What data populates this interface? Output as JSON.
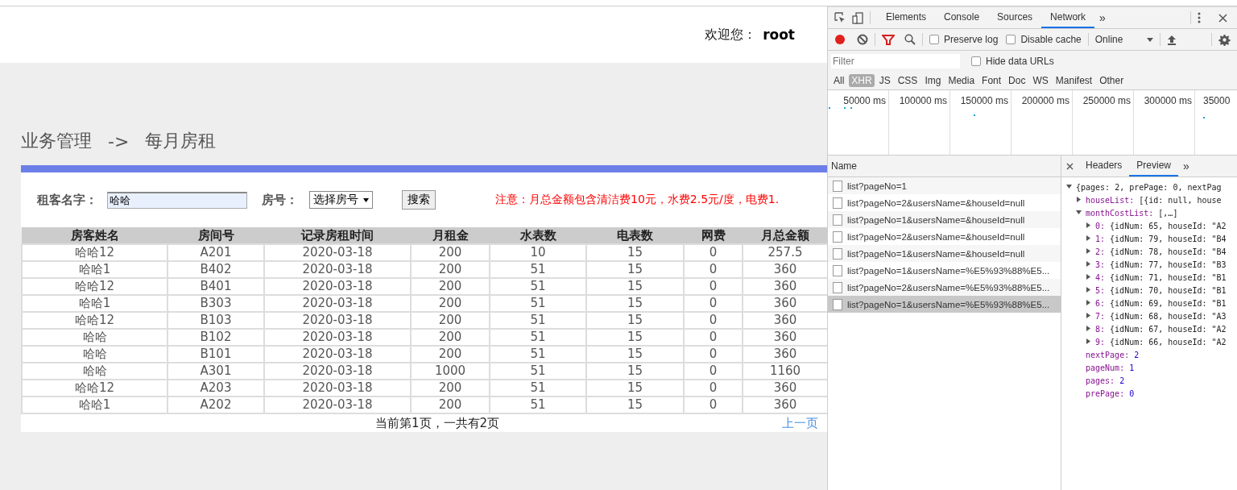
{
  "page": {
    "welcome_label": "欢迎您：",
    "username": "root",
    "breadcrumb": {
      "section": "业务管理",
      "arrow": "->",
      "current": "每月房租"
    },
    "search": {
      "name_label": "租客名字：",
      "name_value": "哈哈",
      "room_label": "房号：",
      "room_select": "选择房号",
      "search_button": "搜索",
      "notice": "注意：月总金额包含清洁费10元，水费2.5元/度，电费1."
    },
    "table": {
      "columns": [
        "房客姓名",
        "房间号",
        "记录房租时间",
        "月租金",
        "水表数",
        "电表数",
        "网费",
        "月总金额"
      ],
      "rows": [
        [
          "哈哈12",
          "A201",
          "2020-03-18",
          "200",
          "10",
          "15",
          "0",
          "257.5"
        ],
        [
          "哈哈1",
          "B402",
          "2020-03-18",
          "200",
          "51",
          "15",
          "0",
          "360"
        ],
        [
          "哈哈12",
          "B401",
          "2020-03-18",
          "200",
          "51",
          "15",
          "0",
          "360"
        ],
        [
          "哈哈1",
          "B303",
          "2020-03-18",
          "200",
          "51",
          "15",
          "0",
          "360"
        ],
        [
          "哈哈12",
          "B103",
          "2020-03-18",
          "200",
          "51",
          "15",
          "0",
          "360"
        ],
        [
          "哈哈",
          "B102",
          "2020-03-18",
          "200",
          "51",
          "15",
          "0",
          "360"
        ],
        [
          "哈哈",
          "B101",
          "2020-03-18",
          "200",
          "51",
          "15",
          "0",
          "360"
        ],
        [
          "哈哈",
          "A301",
          "2020-03-18",
          "1000",
          "51",
          "15",
          "0",
          "1160"
        ],
        [
          "哈哈12",
          "A203",
          "2020-03-18",
          "200",
          "51",
          "15",
          "0",
          "360"
        ],
        [
          "哈哈1",
          "A202",
          "2020-03-18",
          "200",
          "51",
          "15",
          "0",
          "360"
        ]
      ]
    },
    "pagination": {
      "status": "当前第1页，一共有2页",
      "prev_link": "上一页"
    }
  },
  "devtools": {
    "tabs": [
      {
        "label": "Elements",
        "selected": false
      },
      {
        "label": "Console",
        "selected": false
      },
      {
        "label": "Sources",
        "selected": false
      },
      {
        "label": "Network",
        "selected": true
      }
    ],
    "more_tabs": "»",
    "toolbar": {
      "recording": true,
      "filter_active": true,
      "preserve_log": {
        "label": "Preserve log",
        "checked": false
      },
      "disable_cache": {
        "label": "Disable cache",
        "checked": false
      },
      "throttle": "Online"
    },
    "filter": {
      "placeholder": "Filter"
    },
    "hide_data_urls": {
      "label": "Hide data URLs",
      "checked": false
    },
    "types": [
      {
        "label": "All",
        "selected": false
      },
      {
        "label": "XHR",
        "selected": true
      },
      {
        "label": "JS",
        "selected": false
      },
      {
        "label": "CSS",
        "selected": false
      },
      {
        "label": "Img",
        "selected": false
      },
      {
        "label": "Media",
        "selected": false
      },
      {
        "label": "Font",
        "selected": false
      },
      {
        "label": "Doc",
        "selected": false
      },
      {
        "label": "WS",
        "selected": false
      },
      {
        "label": "Manifest",
        "selected": false
      },
      {
        "label": "Other",
        "selected": false
      }
    ],
    "timeline_ticks": [
      "50000 ms",
      "100000 ms",
      "150000 ms",
      "200000 ms",
      "250000 ms",
      "300000 ms",
      "35000"
    ],
    "requests": {
      "header": "Name",
      "items": [
        {
          "label": "list?pageNo=1",
          "selected": false
        },
        {
          "label": "list?pageNo=2&usersName=&houseId=null",
          "selected": false
        },
        {
          "label": "list?pageNo=1&usersName=&houseId=null",
          "selected": false
        },
        {
          "label": "list?pageNo=2&usersName=&houseId=null",
          "selected": false
        },
        {
          "label": "list?pageNo=1&usersName=&houseId=null",
          "selected": false
        },
        {
          "label": "list?pageNo=1&usersName=%E5%93%88%E5...",
          "selected": false
        },
        {
          "label": "list?pageNo=2&usersName=%E5%93%88%E5...",
          "selected": false
        },
        {
          "label": "list?pageNo=1&usersName=%E5%93%88%E5...",
          "selected": true
        }
      ]
    },
    "detail_tabs": [
      {
        "label": "Headers",
        "selected": false
      },
      {
        "label": "Preview",
        "selected": true
      }
    ],
    "preview": {
      "kind": "object",
      "expanded": true,
      "value": "{pages: 2, prePage: 0, nextPag",
      "children": [
        {
          "kind": "object",
          "expanded": false,
          "key": "houseList:",
          "value": "[{id: null, house"
        },
        {
          "kind": "object",
          "expanded": true,
          "key": "monthCostList:",
          "value": "[,…]",
          "children": [
            {
              "kind": "object",
              "expanded": false,
              "key": "0:",
              "value": "{idNum: 65, houseId: \"A2"
            },
            {
              "kind": "object",
              "expanded": false,
              "key": "1:",
              "value": "{idNum: 79, houseId: \"B4"
            },
            {
              "kind": "object",
              "expanded": false,
              "key": "2:",
              "value": "{idNum: 78, houseId: \"B4"
            },
            {
              "kind": "object",
              "expanded": false,
              "key": "3:",
              "value": "{idNum: 77, houseId: \"B3"
            },
            {
              "kind": "object",
              "expanded": false,
              "key": "4:",
              "value": "{idNum: 71, houseId: \"B1"
            },
            {
              "kind": "object",
              "expanded": false,
              "key": "5:",
              "value": "{idNum: 70, houseId: \"B1"
            },
            {
              "kind": "object",
              "expanded": false,
              "key": "6:",
              "value": "{idNum: 69, houseId: \"B1"
            },
            {
              "kind": "object",
              "expanded": false,
              "key": "7:",
              "value": "{idNum: 68, houseId: \"A3"
            },
            {
              "kind": "object",
              "expanded": false,
              "key": "8:",
              "value": "{idNum: 67, houseId: \"A2"
            },
            {
              "kind": "object",
              "expanded": false,
              "key": "9:",
              "value": "{idNum: 66, houseId: \"A2"
            }
          ]
        },
        {
          "kind": "number",
          "key": "nextPage:",
          "value": "2"
        },
        {
          "kind": "number",
          "key": "pageNum:",
          "value": "1"
        },
        {
          "kind": "number",
          "key": "pages:",
          "value": "2"
        },
        {
          "kind": "number",
          "key": "prePage:",
          "value": "0"
        }
      ]
    }
  }
}
